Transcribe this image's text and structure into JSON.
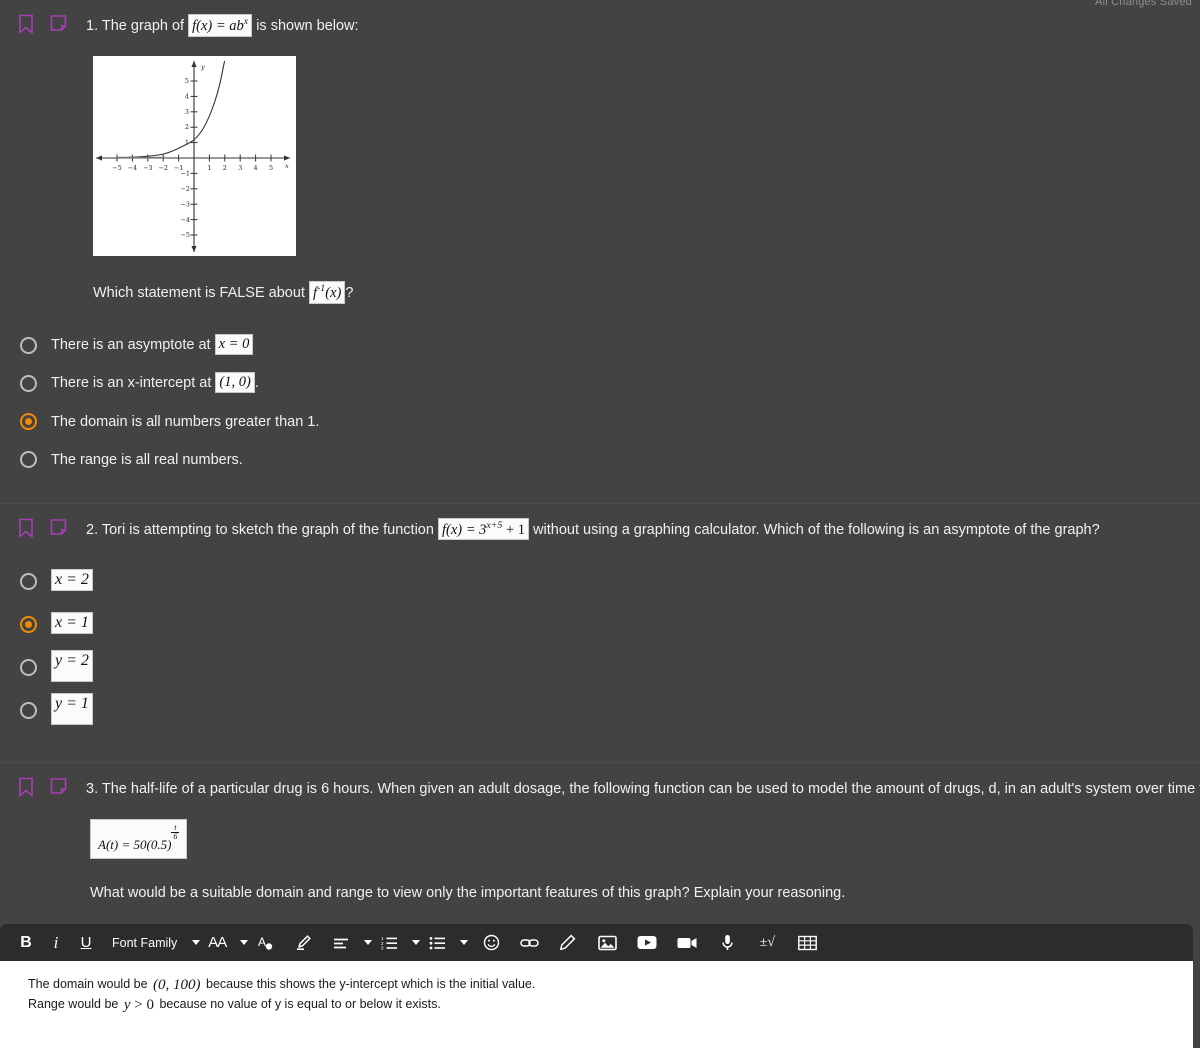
{
  "status": {
    "saved_label": "All Changes Saved"
  },
  "icons": {
    "flag": "bookmark-flag-icon",
    "note": "sticky-note-icon"
  },
  "questions": [
    {
      "number": "1.",
      "text_before": "1. The graph of",
      "math": "f(x) = ab",
      "math_exponent": "x",
      "text_after": "is shown below:",
      "sub_prompt_before": "Which statement is FALSE about",
      "sub_prompt_math": "f",
      "sub_prompt_math_sup": "-1",
      "sub_prompt_math_arg": "(x)",
      "sub_prompt_after": "?",
      "choices": [
        {
          "label_before": "There is an asymptote at",
          "math": "x = 0",
          "label_after": "",
          "selected": false
        },
        {
          "label_before": "There is an x-intercept at",
          "math": "(1, 0)",
          "label_after": ".",
          "selected": false
        },
        {
          "label_before": "The domain is all numbers greater than 1.",
          "math": "",
          "label_after": "",
          "selected": true
        },
        {
          "label_before": "The range is all real numbers.",
          "math": "",
          "label_after": "",
          "selected": false
        }
      ]
    },
    {
      "number": "2.",
      "text_before": "2. Tori is attempting to sketch the graph of the function",
      "math": "f(x) = 3",
      "math_exponent": "x+5",
      "math_tail": "+ 1",
      "text_after": "without using a graphing calculator.  Which of the following is an asymptote of the graph?",
      "choices": [
        {
          "math": "x = 2",
          "selected": false
        },
        {
          "math": "x = 1",
          "selected": true
        },
        {
          "math": "y = 2",
          "selected": false
        },
        {
          "math": "y = 1",
          "selected": false
        }
      ]
    },
    {
      "number": "3.",
      "text": "3. The half-life of a particular drug is 6 hours.  When given an adult dosage, the following function can be used to model the amount of drugs, d, in an adult's system over time t in hours:",
      "formula_lhs": "A(t) = 50(0.5)",
      "formula_exp_num": "t",
      "formula_exp_den": "6",
      "prompt": "What would be a suitable domain and range to view only the important features of this graph? Explain your reasoning."
    }
  ],
  "chart_data": {
    "type": "line",
    "title": "",
    "xlabel": "x",
    "ylabel": "y",
    "xlim": [
      -6,
      6
    ],
    "ylim": [
      -6,
      6
    ],
    "xticks": [
      -5,
      -4,
      -3,
      -2,
      -1,
      1,
      2,
      3,
      4,
      5
    ],
    "yticks": [
      -5,
      -4,
      -3,
      -2,
      -1,
      1,
      2,
      3,
      4,
      5
    ],
    "grid": false,
    "legend": "none",
    "series": [
      {
        "name": "f(x) = ab^x",
        "points": [
          [
            -5,
            0.03
          ],
          [
            -4.5,
            0.05
          ],
          [
            -4,
            0.08
          ],
          [
            -3.5,
            0.12
          ],
          [
            -3,
            0.18
          ],
          [
            -2.5,
            0.25
          ],
          [
            -2,
            0.33
          ],
          [
            -1.5,
            0.45
          ],
          [
            -1,
            0.58
          ],
          [
            -0.5,
            0.78
          ],
          [
            0,
            1.0
          ],
          [
            0.25,
            1.2
          ],
          [
            0.5,
            1.45
          ],
          [
            0.75,
            1.75
          ],
          [
            1,
            2.1
          ],
          [
            1.25,
            2.6
          ],
          [
            1.5,
            3.3
          ],
          [
            1.65,
            4.1
          ],
          [
            1.8,
            5.1
          ],
          [
            1.9,
            5.9
          ]
        ]
      }
    ]
  },
  "editor": {
    "toolbar": {
      "bold": "B",
      "italic": "i",
      "underline": "U",
      "font_family": "Font Family",
      "font_size": "AA",
      "text_color": "text-color-icon",
      "highlight": "highlighter-icon",
      "align": "align-left-icon",
      "ordered_list": "ordered-list-icon",
      "unordered_list": "unordered-list-icon",
      "emoji": "emoji-icon",
      "link": "link-icon",
      "draw": "pencil-icon",
      "image": "image-icon",
      "video": "youtube-icon",
      "record": "video-camera-icon",
      "audio": "microphone-icon",
      "equation": "equation-icon",
      "table": "table-icon"
    },
    "answer": {
      "line1_before": "The domain would be",
      "line1_math": "(0, 100)",
      "line1_after": "because this shows the y-intercept which is the initial value.",
      "line2_before": "Range would be",
      "line2_math_lhs": "y",
      "line2_math_op": ">",
      "line2_math_rhs": "0",
      "line2_after": "because no value of y is equal to or below it exists."
    }
  },
  "colors": {
    "background": "#434343",
    "accent_selected": "#f08a00",
    "icon_purple": "#a83fb0",
    "toolbar_bg": "#2c2c2c"
  }
}
